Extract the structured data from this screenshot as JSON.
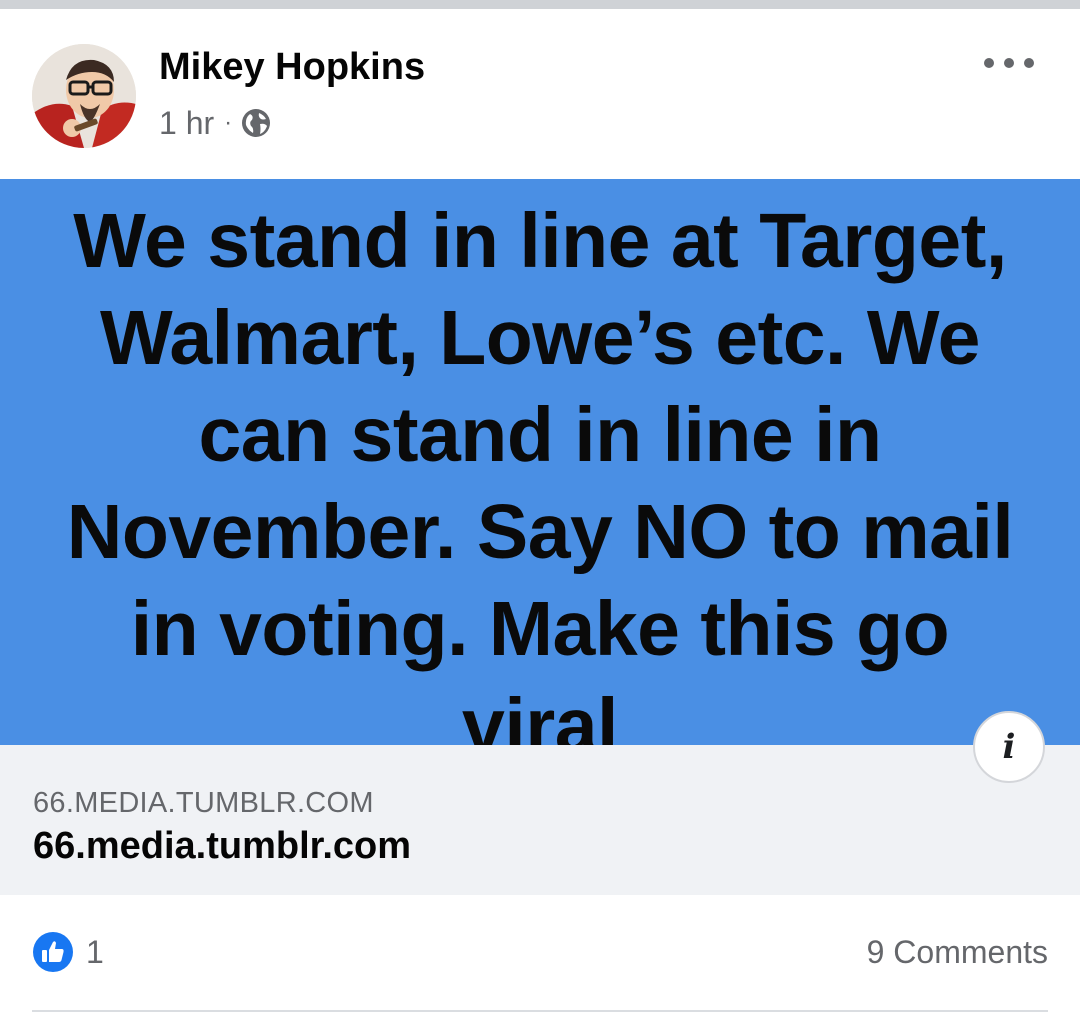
{
  "post": {
    "author": "Mikey Hopkins",
    "time": "1 hr",
    "separator": "·",
    "audience_icon": "globe-icon",
    "more_icon": "more-options-icon",
    "image_text": "We stand in line at Target, Walmart, Lowe’s etc. We can stand in line in November. Say NO to mail in voting. Make this go viral",
    "image_background": "#4a8fe4",
    "info_label": "i"
  },
  "link_preview": {
    "domain_caps": "66.MEDIA.TUMBLR.COM",
    "domain": "66.media.tumblr.com"
  },
  "engagement": {
    "reaction_icon": "like-icon",
    "reaction_count": "1",
    "comments": "9 Comments"
  },
  "colors": {
    "like_blue": "#1877f2",
    "secondary_text": "#65676b",
    "preview_bg": "#f0f2f5"
  }
}
